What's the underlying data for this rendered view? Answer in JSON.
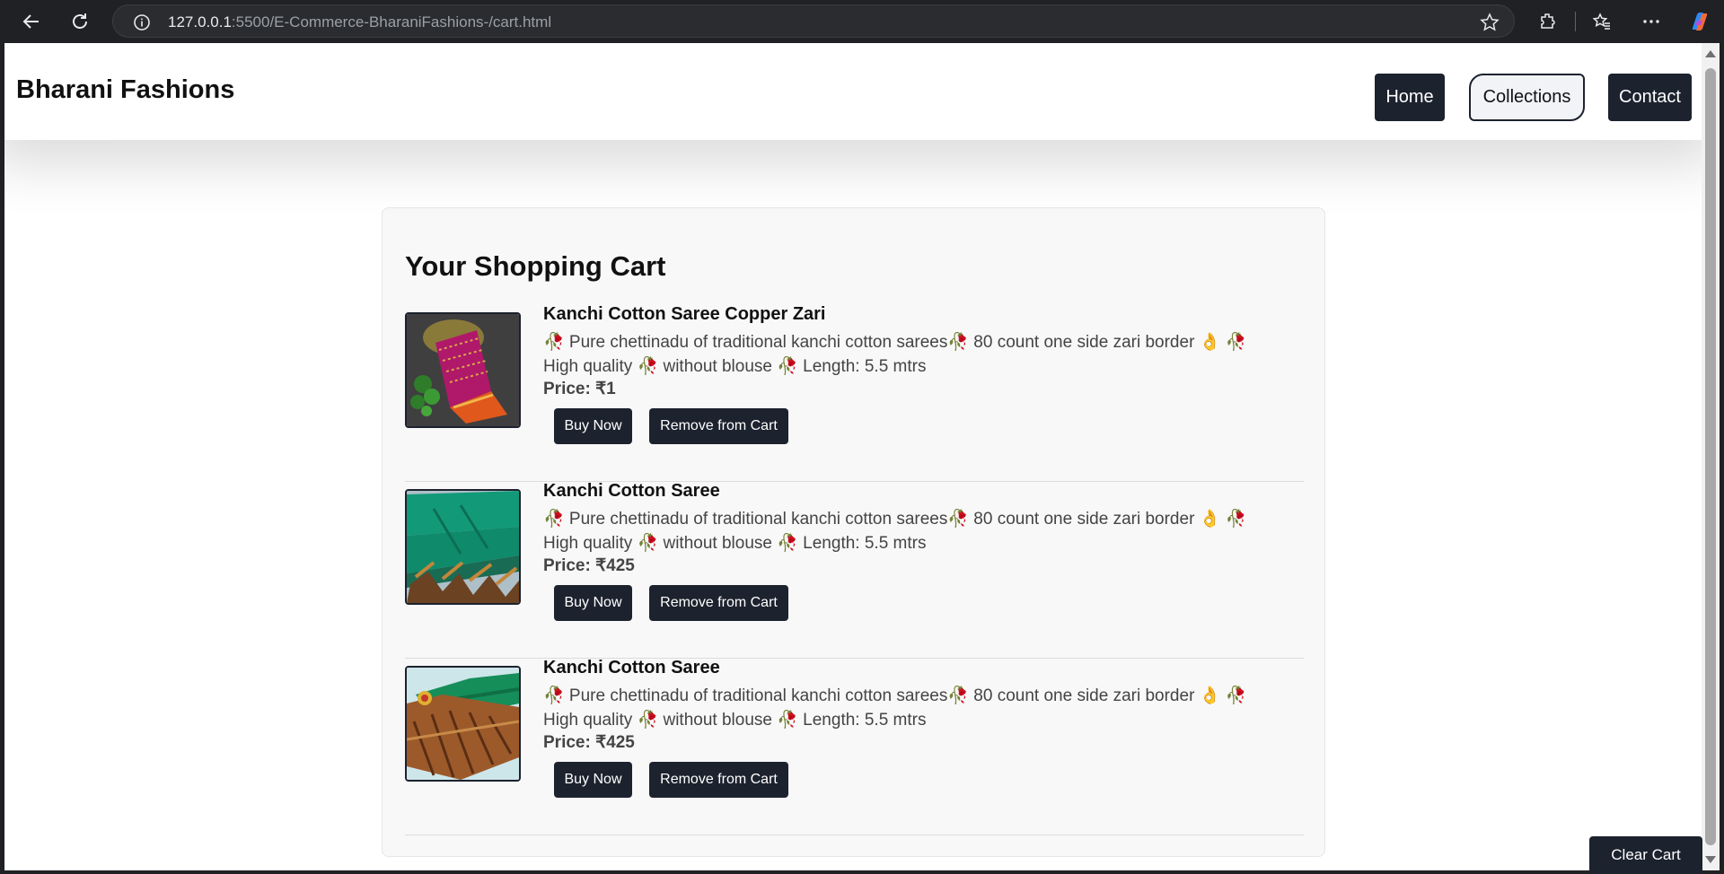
{
  "browser": {
    "url_host": "127.0.0.1",
    "url_path": ":5500/E-Commerce-BharaniFashions-/cart.html"
  },
  "header": {
    "brand": "Bharani Fashions",
    "nav": [
      "Home",
      "Collections",
      "Contact"
    ]
  },
  "cart": {
    "title": "Your Shopping Cart",
    "items": [
      {
        "name": "Kanchi Cotton Saree Copper Zari",
        "desc_line1": "🥀 Pure chettinadu of traditional kanchi cotton sarees🥀  80 count one side zari border  👌 🥀",
        "desc_line2": "High quality 🥀  without blouse  🥀 Length: 5.5 mtrs",
        "price": "Price: ₹1",
        "buy_label": "Buy Now",
        "remove_label": "Remove from Cart",
        "image": "pink-saree-image"
      },
      {
        "name": "Kanchi Cotton Saree",
        "desc_line1": "🥀 Pure chettinadu of traditional kanchi cotton sarees🥀  80 count one side zari border  👌 🥀",
        "desc_line2": "High quality 🥀  without blouse  🥀 Length: 5.5 mtrs",
        "price": "Price: ₹425",
        "buy_label": "Buy Now",
        "remove_label": "Remove from Cart",
        "image": "green-saree-image"
      },
      {
        "name": "Kanchi Cotton Saree",
        "desc_line1": "🥀 Pure chettinadu of traditional kanchi cotton sarees🥀  80 count one side zari border  👌 🥀",
        "desc_line2": "High quality 🥀  without blouse  🥀 Length: 5.5 mtrs",
        "price": "Price: ₹425",
        "buy_label": "Buy Now",
        "remove_label": "Remove from Cart",
        "image": "copper-saree-image"
      }
    ],
    "clear_label": "Clear Cart"
  },
  "colors": {
    "button_dark": "#1c222e",
    "chrome_bg": "#202124",
    "card_bg": "#f8f8f8"
  }
}
